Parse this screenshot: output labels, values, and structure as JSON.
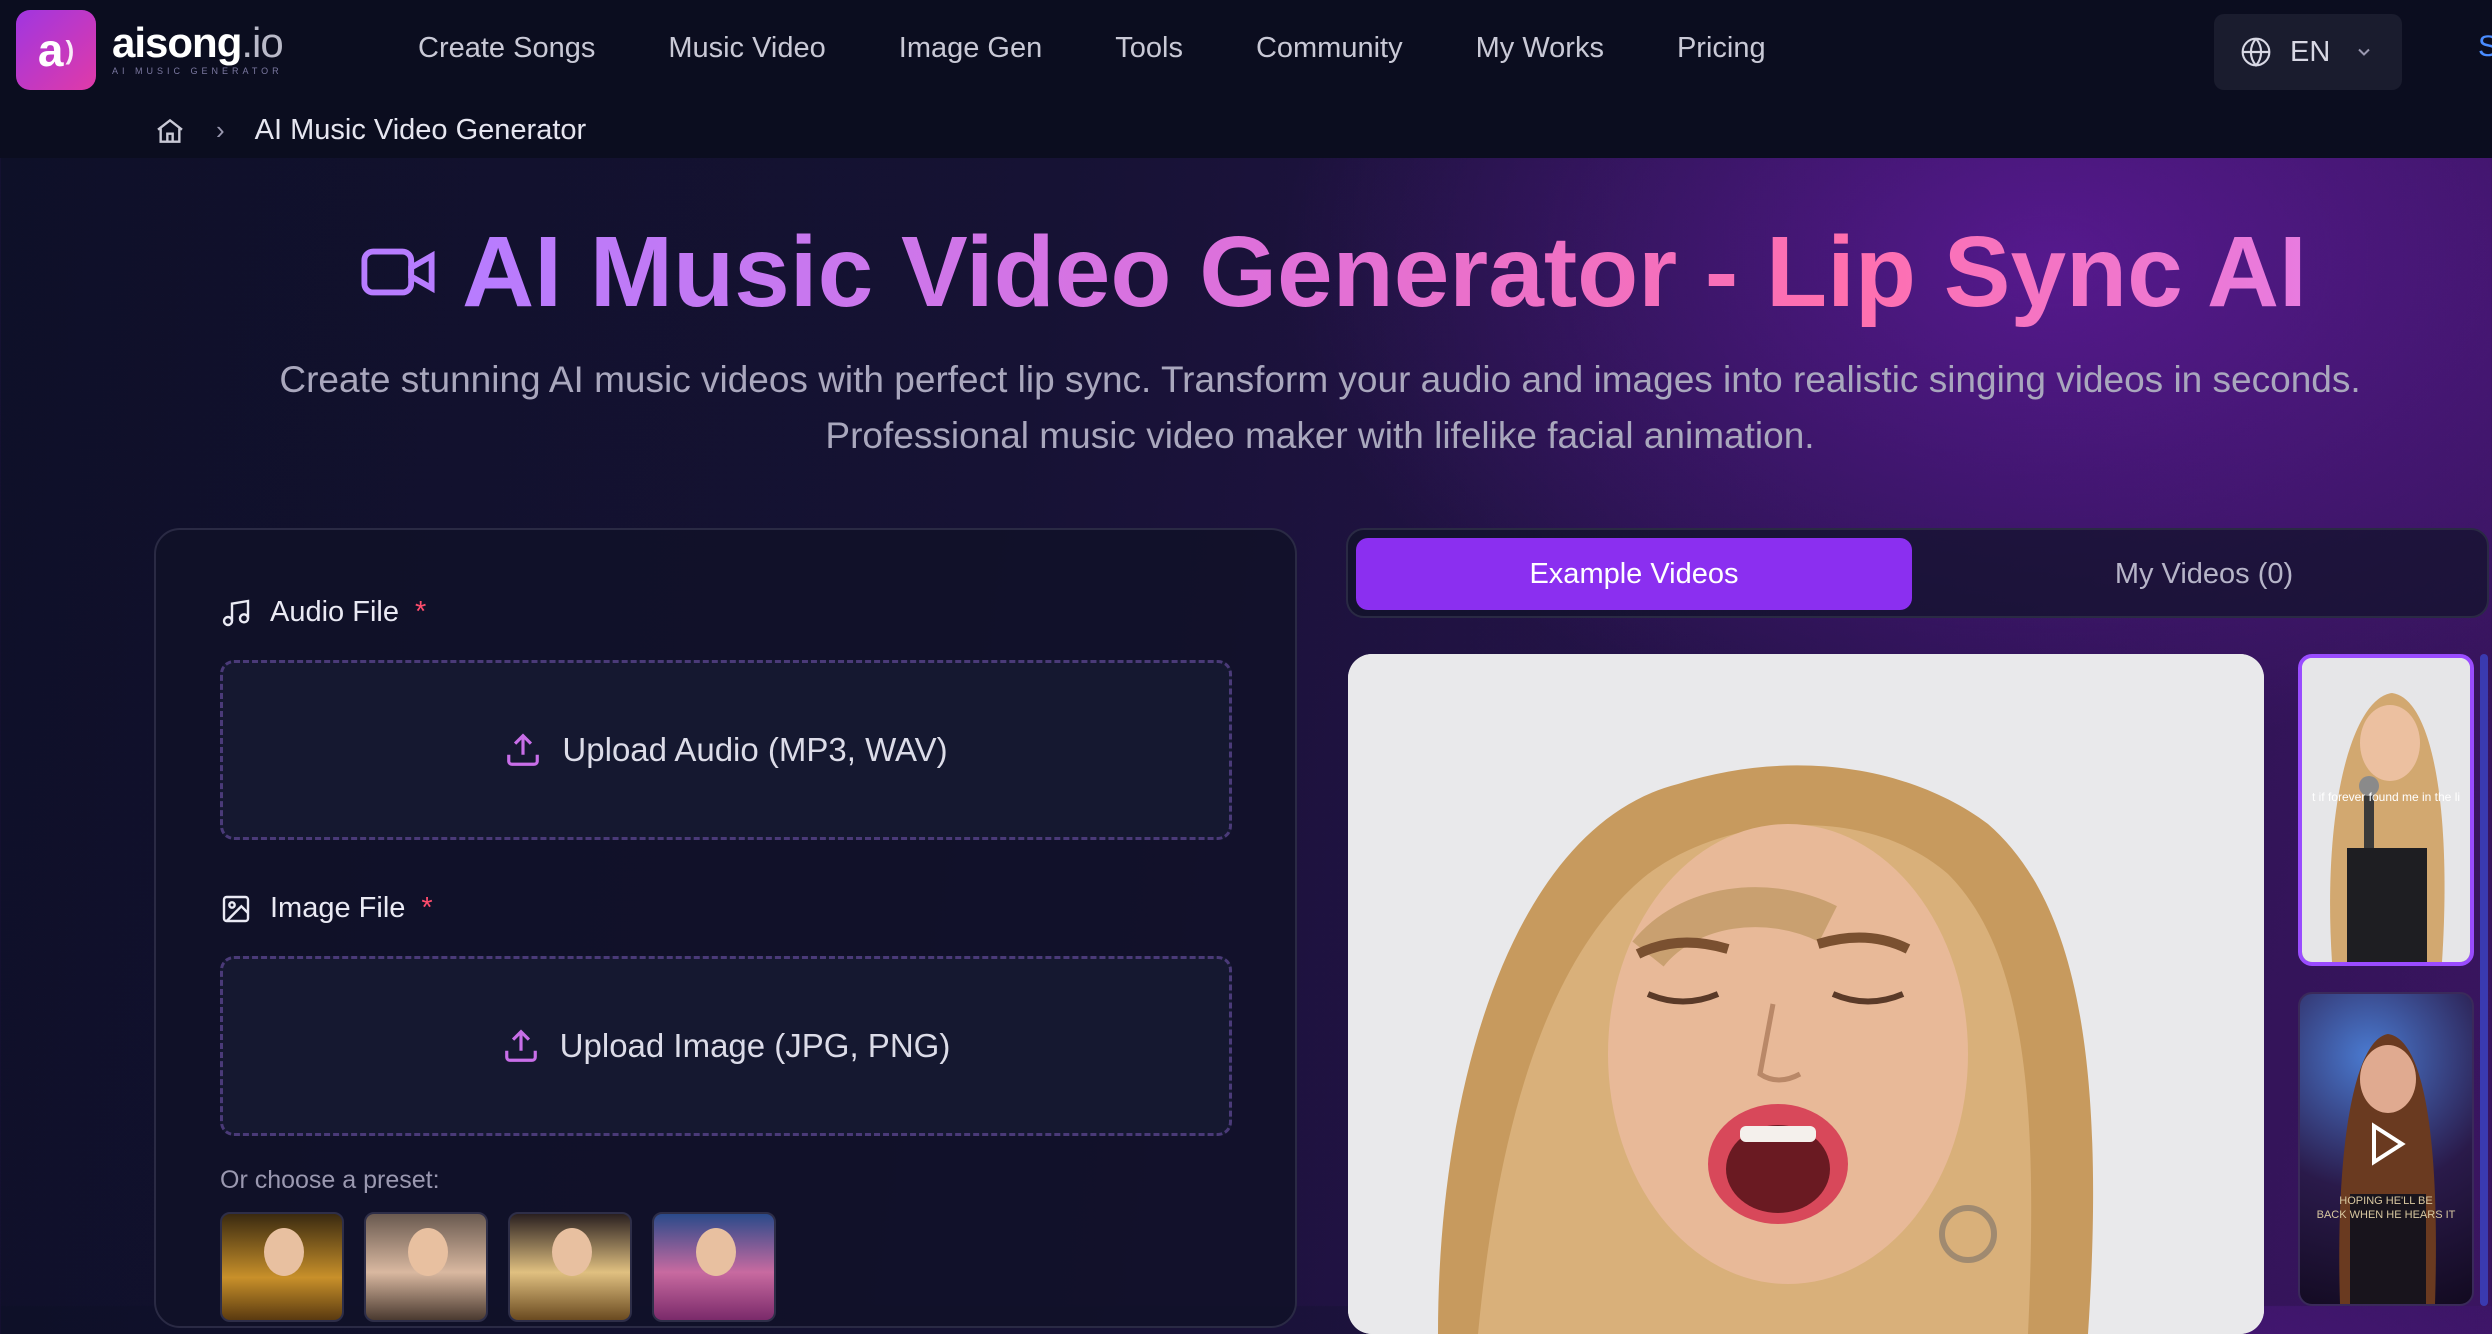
{
  "header": {
    "logo_letter": "a",
    "brand_name": "aisong",
    "brand_suffix": ".io",
    "brand_tagline": "AI MUSIC GENERATOR",
    "nav": [
      "Create Songs",
      "Music Video",
      "Image Gen",
      "Tools",
      "Community",
      "My Works",
      "Pricing"
    ],
    "language": "EN",
    "edge_text": "S"
  },
  "breadcrumb": {
    "current": "AI Music Video Generator"
  },
  "hero": {
    "title": "AI Music Video Generator - Lip Sync AI",
    "subtitle_line1": "Create stunning AI music videos with perfect lip sync. Transform your audio and images into realistic singing videos in seconds.",
    "subtitle_line2": "Professional music video maker with lifelike facial animation."
  },
  "form": {
    "audio_label": "Audio File",
    "audio_required": "*",
    "audio_upload": "Upload Audio (MP3, WAV)",
    "image_label": "Image File",
    "image_required": "*",
    "image_upload": "Upload Image (JPG, PNG)",
    "preset_label": "Or choose a preset:"
  },
  "tabs": {
    "example": "Example Videos",
    "mine": "My Videos (0)"
  },
  "thumbs": {
    "caption1": "t if forever found me in the li",
    "caption2_line1": "HOPING HE'LL BE",
    "caption2_line2": "BACK WHEN HE HEARS IT"
  },
  "colors": {
    "accent": "#8b2ff0",
    "required": "#ff4d6d",
    "title_gradient_start": "#b77cff",
    "title_gradient_end": "#ff6fae"
  }
}
